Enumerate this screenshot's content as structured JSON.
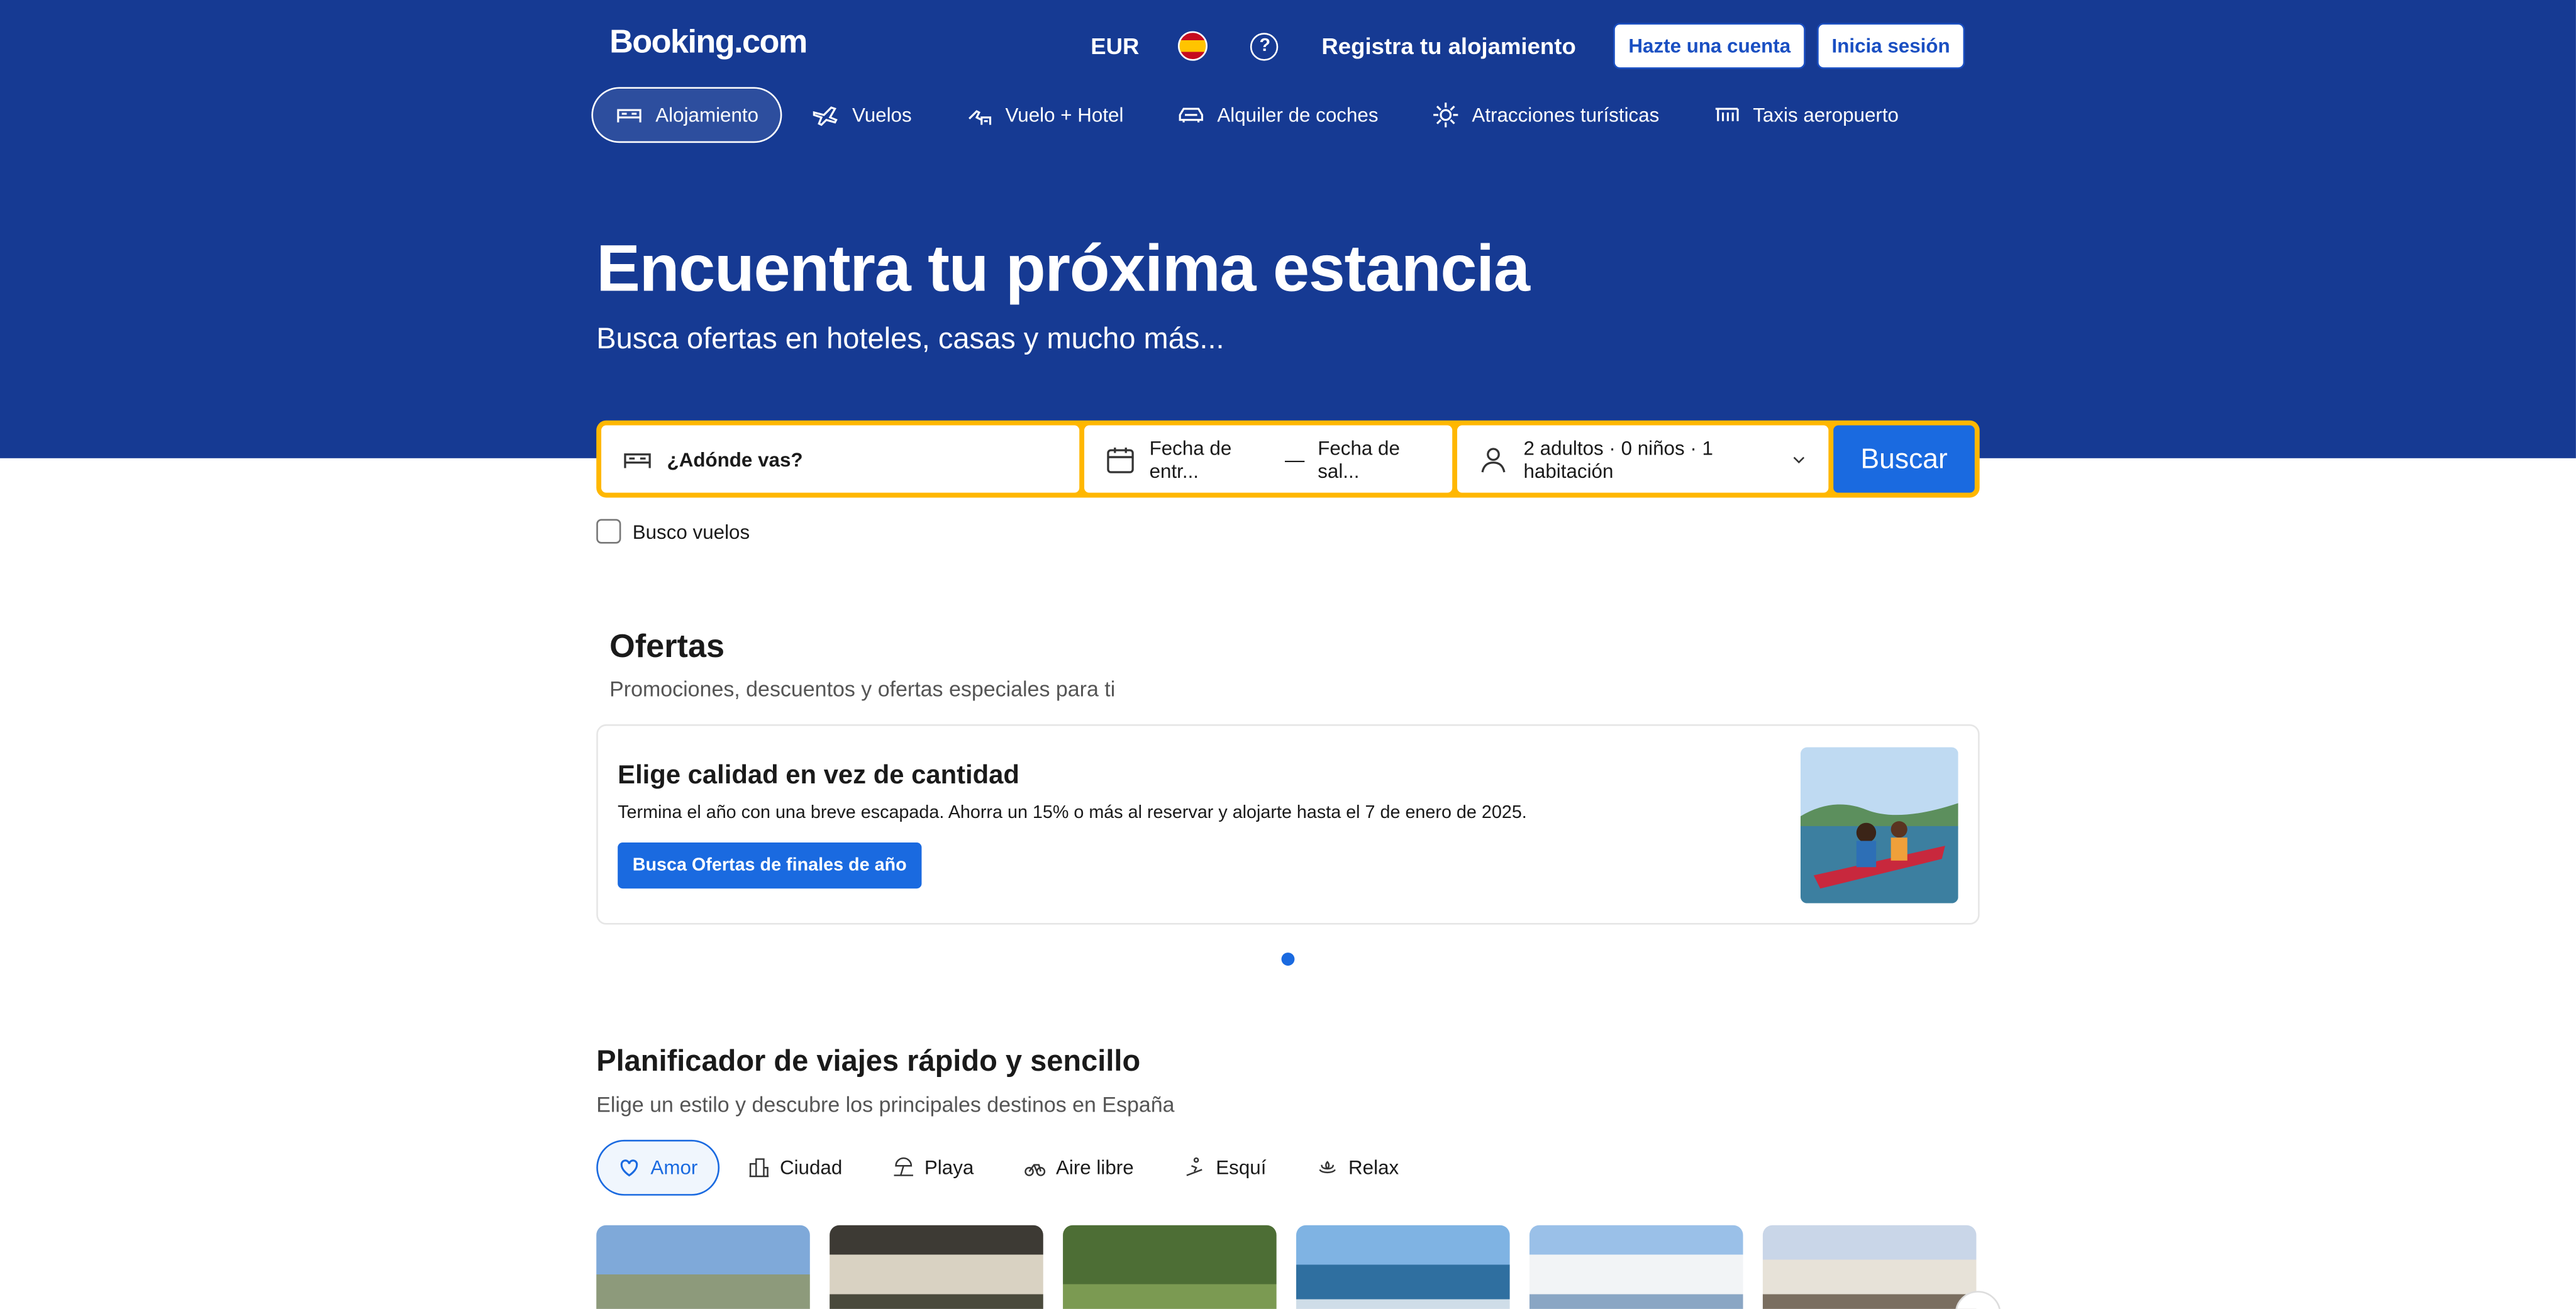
{
  "header": {
    "logo": "Booking.com",
    "currency": "EUR",
    "register_property": "Registra tu alojamiento",
    "create_account": "Hazte una cuenta",
    "sign_in": "Inicia sesión"
  },
  "nav": [
    {
      "label": "Alojamiento",
      "icon": "bed-icon",
      "active": true
    },
    {
      "label": "Vuelos",
      "icon": "plane-icon"
    },
    {
      "label": "Vuelo + Hotel",
      "icon": "flight-hotel-icon"
    },
    {
      "label": "Alquiler de coches",
      "icon": "car-icon"
    },
    {
      "label": "Atracciones turísticas",
      "icon": "attractions-icon"
    },
    {
      "label": "Taxis aeropuerto",
      "icon": "taxi-icon"
    }
  ],
  "hero": {
    "title": "Encuentra tu próxima estancia",
    "subtitle": "Busca ofertas en hoteles, casas y mucho más..."
  },
  "search": {
    "destination_placeholder": "¿Adónde vas?",
    "checkin": "Fecha de entr...",
    "checkout": "Fecha de sal...",
    "date_separator": "—",
    "guests": "2 adultos · 0 niños · 1 habitación",
    "button": "Buscar",
    "flights_checkbox": "Busco vuelos"
  },
  "offers": {
    "title": "Ofertas",
    "subtitle": "Promociones, descuentos y ofertas especiales para ti",
    "card_title": "Elige calidad en vez de cantidad",
    "card_text": "Termina el año con una breve escapada. Ahorra un 15% o más al reservar y alojarte hasta el 7 de enero de 2025.",
    "card_button": "Busca Ofertas de finales de año"
  },
  "planner": {
    "title": "Planificador de viajes rápido y sencillo",
    "subtitle": "Elige un estilo y descubre los principales destinos en España",
    "chips": [
      {
        "label": "Amor",
        "icon": "heart-icon",
        "active": true
      },
      {
        "label": "Ciudad",
        "icon": "city-icon"
      },
      {
        "label": "Playa",
        "icon": "beach-icon"
      },
      {
        "label": "Aire libre",
        "icon": "bike-icon"
      },
      {
        "label": "Esquí",
        "icon": "ski-icon"
      },
      {
        "label": "Relax",
        "icon": "relax-icon"
      }
    ]
  },
  "colors": {
    "brand_blue": "#163a93",
    "action_blue": "#1a6ae0",
    "search_border": "#ffb700"
  }
}
